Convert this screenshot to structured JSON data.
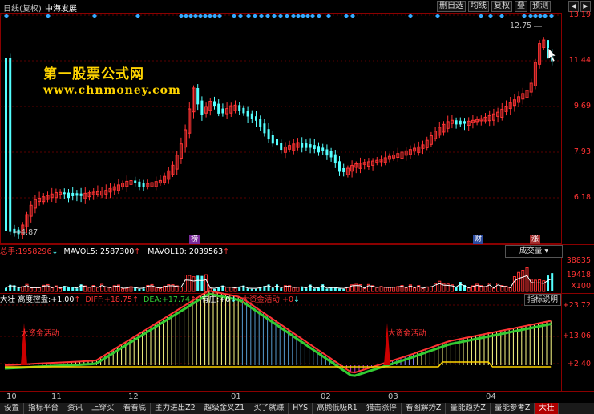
{
  "topbar": {
    "period": "日线(复权)",
    "stock": "中海发展",
    "buttons": [
      "删自选",
      "均线",
      "复权",
      "叠",
      "预测"
    ],
    "arrows": [
      "◀",
      "▶"
    ]
  },
  "watermark": {
    "line1": "第一股票公式网",
    "line2": "www.chnmoney.com"
  },
  "price_axis": [
    "13.19",
    "11.44",
    "9.69",
    "7.93",
    "6.18"
  ],
  "price_high": "12.75",
  "price_low": "4.87",
  "markers": {
    "m1": "榜",
    "m2": "财",
    "m3": "涨"
  },
  "volume": {
    "total_label": "总手:",
    "total_value": "1958296",
    "mavol5_label": "MAVOL5:",
    "mavol5_value": "2587300",
    "mavol10_label": "MAVOL10:",
    "mavol10_value": "2039563",
    "dropdown": "成交量",
    "axis": [
      "38835",
      "19418",
      "X100"
    ]
  },
  "indicator": {
    "name": "大壮",
    "items": [
      {
        "label": "高度控盘:",
        "value": "+1.00"
      },
      {
        "label": "DIFF:",
        "value": "+18.75"
      },
      {
        "label": "DEA:",
        "value": "+17.74"
      },
      {
        "label": "有庄:",
        "value": "+0"
      },
      {
        "label": "大资金活动:",
        "value": "+0"
      }
    ],
    "help_button": "指标说明",
    "axis": [
      "+23.72",
      "+13.06",
      "+2.40"
    ],
    "annotation": "大资金活动"
  },
  "xaxis": [
    "10",
    "11",
    "12",
    "01",
    "02",
    "03",
    "04"
  ],
  "tabs": [
    "设置",
    "指标平台",
    "资讯",
    "上穿买",
    "看看底",
    "主力进出Z2",
    "超级金叉Z1",
    "买了就赚",
    "HYS",
    "高抛低吸R1",
    "猎击涨停",
    "看图解势Z",
    "量能趋势Z",
    "量能参考Z",
    "大壮"
  ],
  "colors": {
    "up": "#ff3333",
    "down": "#54ffff",
    "accent": "#ffd400",
    "diff": "#ff3333",
    "dea": "#33cc33"
  }
}
